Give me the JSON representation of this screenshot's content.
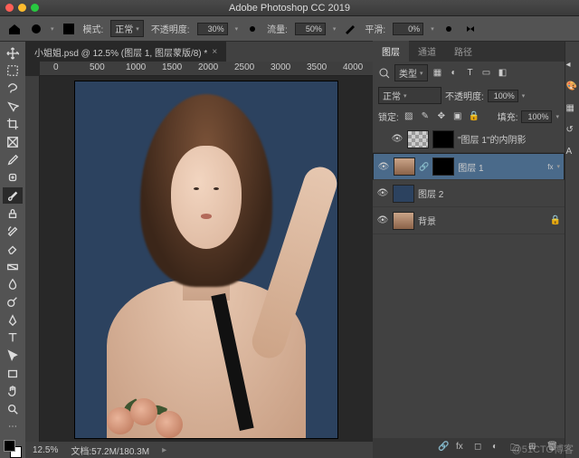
{
  "app_title": "Adobe Photoshop CC 2019",
  "document": {
    "tab_label": "小姐姐.psd @ 12.5% (图层 1, 图层蒙版/8) *"
  },
  "options": {
    "mode_label": "模式:",
    "mode_value": "正常",
    "opacity_label": "不透明度:",
    "opacity_value": "30%",
    "flow_label": "流量:",
    "flow_value": "50%",
    "smooth_label": "平滑:",
    "smooth_value": "0%"
  },
  "ruler_marks": [
    "0",
    "500",
    "1000",
    "1500",
    "2000",
    "2500",
    "3000",
    "3500",
    "4000"
  ],
  "status": {
    "zoom": "12.5%",
    "docinfo": "文档:57.2M/180.3M"
  },
  "panels": {
    "tabs": [
      "图层",
      "通道",
      "路径"
    ],
    "filter_label": "类型",
    "blend_mode": "正常",
    "opacity_label": "不透明度:",
    "opacity_value": "100%",
    "lock_label": "锁定:",
    "fill_label": "填充:",
    "fill_value": "100%"
  },
  "layers": [
    {
      "name": "\"图层 1\"的内阴影",
      "indent": true
    },
    {
      "name": "图层 1",
      "selected": true
    },
    {
      "name": "图层 2"
    },
    {
      "name": "背景",
      "locked": true
    }
  ],
  "watermark": "@51CTO博客"
}
